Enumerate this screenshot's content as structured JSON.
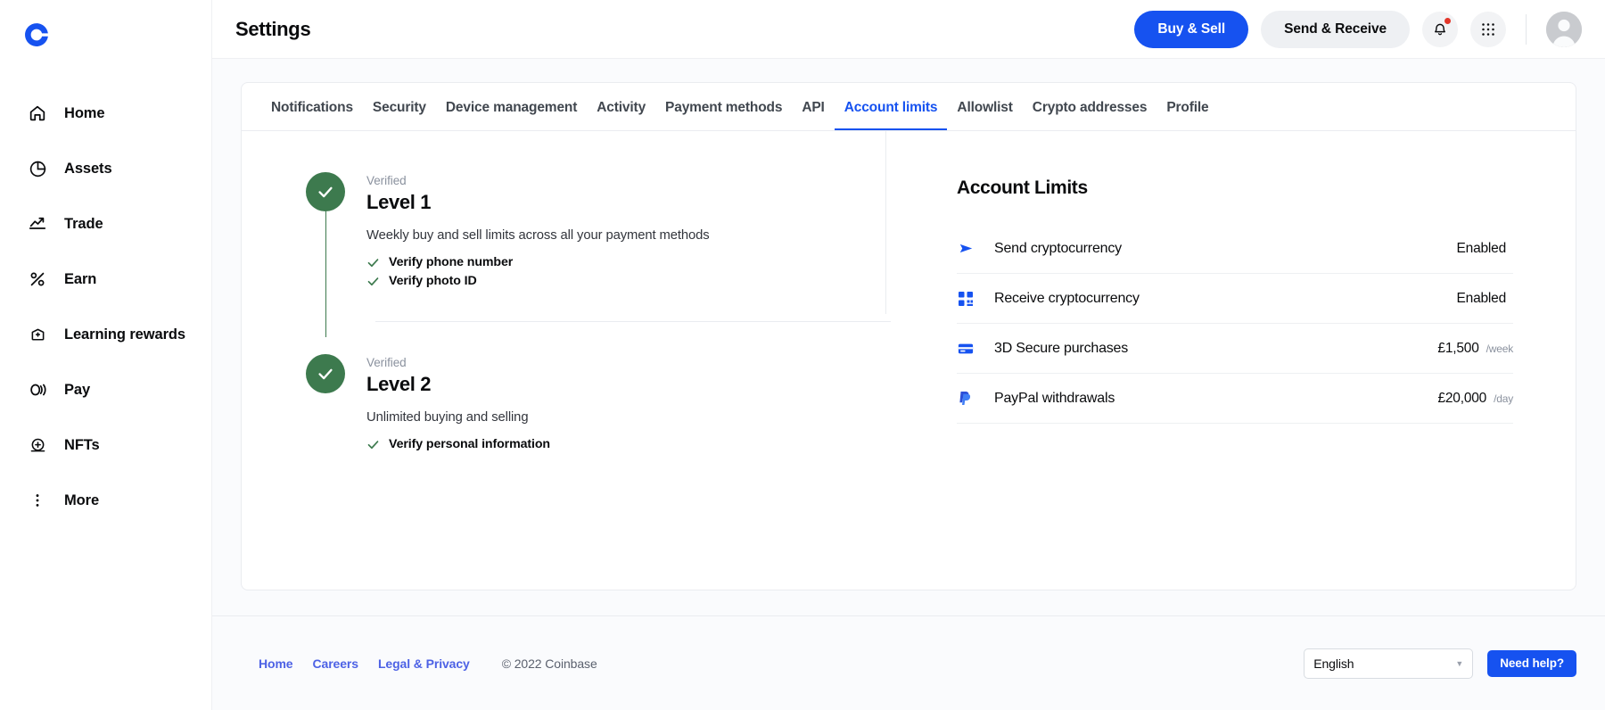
{
  "brand": {
    "logo_icon": "coinbase-logo",
    "accent": "#1652f0",
    "green": "#3d7a4e"
  },
  "sidebar": {
    "items": [
      {
        "label": "Home",
        "icon": "home-icon"
      },
      {
        "label": "Assets",
        "icon": "pie-chart-icon"
      },
      {
        "label": "Trade",
        "icon": "trend-up-icon"
      },
      {
        "label": "Earn",
        "icon": "percent-icon"
      },
      {
        "label": "Learning rewards",
        "icon": "graduation-badge-icon"
      },
      {
        "label": "Pay",
        "icon": "pay-icon"
      },
      {
        "label": "NFTs",
        "icon": "nft-icon"
      },
      {
        "label": "More",
        "icon": "more-vertical-icon"
      }
    ]
  },
  "header": {
    "title": "Settings",
    "buy_sell_label": "Buy & Sell",
    "send_receive_label": "Send & Receive",
    "notifications_icon": "bell-icon",
    "apps_icon": "grid-apps-icon",
    "avatar_icon": "user-avatar"
  },
  "tabs": [
    {
      "label": "Notifications",
      "active": false
    },
    {
      "label": "Security",
      "active": false
    },
    {
      "label": "Device management",
      "active": false
    },
    {
      "label": "Activity",
      "active": false
    },
    {
      "label": "Payment methods",
      "active": false
    },
    {
      "label": "API",
      "active": false
    },
    {
      "label": "Account limits",
      "active": true
    },
    {
      "label": "Allowlist",
      "active": false
    },
    {
      "label": "Crypto addresses",
      "active": false
    },
    {
      "label": "Profile",
      "active": false
    }
  ],
  "levels": [
    {
      "status": "Verified",
      "title": "Level 1",
      "description": "Weekly buy and sell limits across all your payment methods",
      "checks": [
        "Verify phone number",
        "Verify photo ID"
      ]
    },
    {
      "status": "Verified",
      "title": "Level 2",
      "description": "Unlimited buying and selling",
      "checks": [
        "Verify personal information"
      ]
    }
  ],
  "limits": {
    "title": "Account Limits",
    "rows": [
      {
        "icon": "send-arrow-icon",
        "name": "Send cryptocurrency",
        "value": "Enabled",
        "per": ""
      },
      {
        "icon": "qr-code-icon",
        "name": "Receive cryptocurrency",
        "value": "Enabled",
        "per": ""
      },
      {
        "icon": "credit-card-icon",
        "name": "3D Secure purchases",
        "value": "£1,500",
        "per": "/week"
      },
      {
        "icon": "paypal-icon",
        "name": "PayPal withdrawals",
        "value": "£20,000",
        "per": "/day"
      }
    ]
  },
  "footer": {
    "links": [
      "Home",
      "Careers",
      "Legal & Privacy"
    ],
    "copyright": "© 2022 Coinbase",
    "language": "English",
    "help_label": "Need help?"
  }
}
